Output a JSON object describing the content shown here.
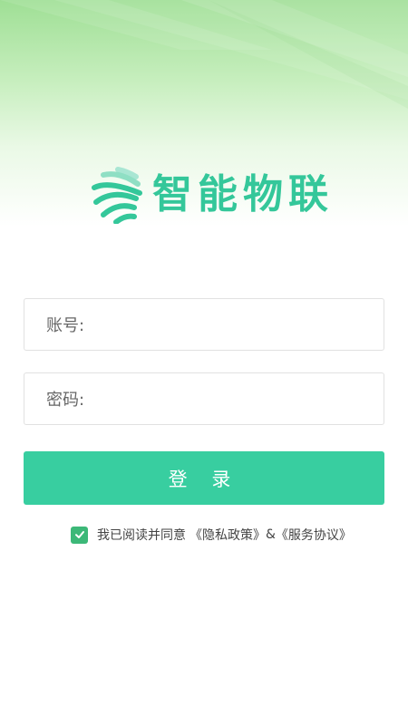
{
  "brand": {
    "name": "智能物联",
    "color": "#34c79a"
  },
  "form": {
    "account_label": "账号:",
    "account_value": "",
    "password_label": "密码:",
    "password_value": ""
  },
  "login_button": {
    "label": "登 录",
    "color": "#38cea0"
  },
  "agreement": {
    "checked": true,
    "prefix": "我已阅读并同意",
    "privacy_link": "《隐私政策》",
    "connector": "&",
    "service_link": "《服务协议》",
    "checkbox_color": "#3cb878"
  },
  "icons": {
    "logo": "logo-mark-icon",
    "checkbox": "checkmark-icon"
  }
}
